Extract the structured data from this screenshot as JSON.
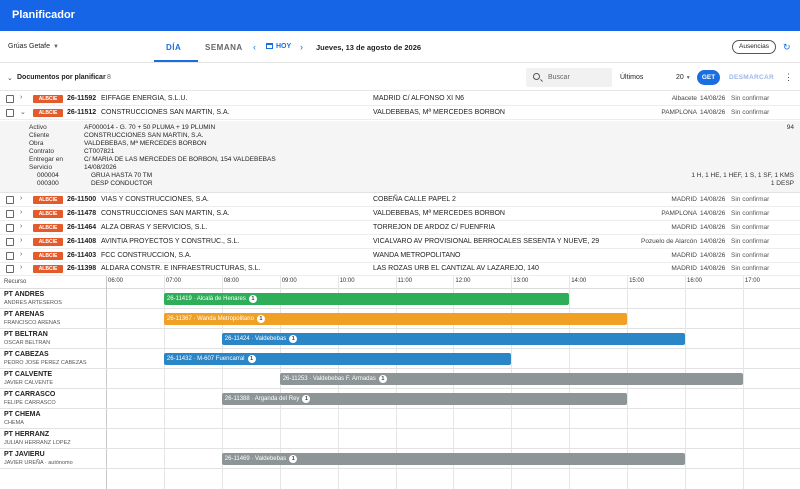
{
  "app": {
    "title": "Planificador"
  },
  "toolbar": {
    "crane_select": "Grúas Getafe",
    "tab_day": "DÍA",
    "tab_week": "SEMANA",
    "today_label": "HOY",
    "current_date": "Jueves, 13 de agosto de 2026",
    "absences_label": "Ausencias"
  },
  "pending": {
    "title": "Documentos por planificar",
    "count": "8",
    "search_placeholder": "Buscar",
    "last_label": "Últimos",
    "last_value": "20",
    "get_label": "GET",
    "unmark_label": "DESMARCAR"
  },
  "docs": [
    {
      "badge": "ALBCIE",
      "code": "26-11592",
      "client": "EIFFAGE ENERGIA, S.L.U.",
      "address": "MADRID C/ ALFONSO XI N6",
      "city": "Albacete",
      "date": "14/08/26",
      "status": "Sin confirmar"
    },
    {
      "badge": "ALBCIE",
      "code": "26-11512",
      "client": "CONSTRUCCIONES SAN MARTIN, S.A.",
      "address": "VALDEBEBAS, Mª MERCEDES BORBON",
      "city": "PAMPLONA",
      "date": "14/08/26",
      "status": "Sin confirmar"
    },
    {
      "badge": "ALBCIE",
      "code": "26-11500",
      "client": "VIAS Y CONSTRUCCIONES, S.A.",
      "address": "COBEÑA CALLE PAPEL 2",
      "city": "MADRID",
      "date": "14/08/26",
      "status": "Sin confirmar"
    },
    {
      "badge": "ALBCIE",
      "code": "26-11478",
      "client": "CONSTRUCCIONES SAN MARTIN, S.A.",
      "address": "VALDEBEBAS, Mª MERCEDES BORBON",
      "city": "PAMPLONA",
      "date": "14/08/26",
      "status": "Sin confirmar"
    },
    {
      "badge": "ALBCIE",
      "code": "26-11464",
      "client": "ALZA OBRAS Y SERVICIOS, S.L.",
      "address": "TORREJON DE ARDOZ C/ FUENFRIA",
      "city": "MADRID",
      "date": "14/08/26",
      "status": "Sin confirmar"
    },
    {
      "badge": "ALBCIE",
      "code": "26-11408",
      "client": "AVINTIA PROYECTOS Y CONSTRUC., S.L.",
      "address": "VICALVARO AV PROVISIONAL BERROCALES SESENTA Y NUEVE, 29",
      "city": "Pozuelo de Alarcón",
      "date": "14/08/26",
      "status": "Sin confirmar"
    },
    {
      "badge": "ALBCIE",
      "code": "26-11403",
      "client": "FCC CONSTRUCCION, S.A.",
      "address": "WANDA METROPOLITANO",
      "city": "MADRID",
      "date": "14/08/26",
      "status": "Sin confirmar"
    },
    {
      "badge": "ALBCIE",
      "code": "26-11398",
      "client": "ALDARA CONSTR. E INFRAESTRUCTURAS, S.L.",
      "address": "LAS ROZAS URB EL CANTIZAL AV LAZAREJO, 140",
      "city": "MADRID",
      "date": "14/08/26",
      "status": "Sin confirmar"
    }
  ],
  "detail": {
    "active_label": "Activo",
    "active_value": "AF000014 - G. 70 + 50 PLUMA + 19 PLUMIN",
    "active_right": "94",
    "client_label": "Cliente",
    "client_value": "CONSTRUCCIONES SAN MARTIN, S.A.",
    "work_label": "Obra",
    "work_value": "VALDEBEBAS, Mª MERCEDES BORBON",
    "contract_label": "Contrato",
    "contract_value": "CT007821",
    "deliver_label_1": "Entregar en",
    "deliver_value": "C/ MARIA DE LAS MERCEDES DE BORBON, 154 VALDEBEBAS",
    "service_label": "Servicio",
    "service_value": "14/08/2026",
    "lines": [
      {
        "code": "000004",
        "desc": "GRUA HASTA 70 TM",
        "right": "1 H, 1 HE, 1 HEF, 1 S, 1 SF, 1 KMS"
      },
      {
        "code": "000300",
        "desc": "DESP CONDUCTOR",
        "right": "1 DESP"
      }
    ]
  },
  "timeline": {
    "resource_header": "Recurso",
    "hours": [
      "06:00",
      "07:00",
      "08:00",
      "09:00",
      "10:00",
      "11:00",
      "12:00",
      "13:00",
      "14:00",
      "15:00",
      "16:00",
      "17:00"
    ],
    "resources": [
      {
        "name": "PT ANDRES",
        "sub": "ANDRES ARTESEROS",
        "bar": {
          "label": "26-11419 · Alcalá de Henares",
          "count": "1",
          "color": "#2fae5a",
          "start": 7.0,
          "end": 14.0
        }
      },
      {
        "name": "PT ARENAS",
        "sub": "FRANCISCO ARENAS",
        "bar": {
          "label": "26-11367 · Wanda Metropolitano",
          "count": "1",
          "color": "#f0a024",
          "start": 7.0,
          "end": 15.0
        }
      },
      {
        "name": "PT BELTRAN",
        "sub": "OSCAR BELTRAN",
        "bar": {
          "label": "26-11424 · Valdebebas",
          "count": "1",
          "color": "#2b86c8",
          "start": 8.0,
          "end": 16.0
        }
      },
      {
        "name": "PT CABEZAS",
        "sub": "PEDRO JOSE PEREZ CABEZAS",
        "bar": {
          "label": "26-11432 · M-607 Fuencarral",
          "count": "1",
          "color": "#2b86c8",
          "start": 7.0,
          "end": 13.0
        }
      },
      {
        "name": "PT CALVENTE",
        "sub": "JAVIER CALVENTE",
        "bar": {
          "label": "26-11253 · Valdebebas F. Armadas",
          "count": "1",
          "color": "#8e9597",
          "start": 9.0,
          "end": 17.0
        }
      },
      {
        "name": "PT CARRASCO",
        "sub": "FELIPE CARRASCO",
        "bar": {
          "label": "26-11388 · Arganda del Rey",
          "count": "1",
          "color": "#8e9597",
          "start": 8.0,
          "end": 15.0
        }
      },
      {
        "name": "PT CHEMA",
        "sub": "CHEMA",
        "bar": null
      },
      {
        "name": "PT HERRANZ",
        "sub": "JULIAN HERRANZ LOPEZ",
        "bar": null
      },
      {
        "name": "PT JAVIERU",
        "sub": "JAVIER UREÑA · autónomo",
        "bar": {
          "label": "26-11469 · Valdebebas",
          "count": "1",
          "color": "#8e9597",
          "start": 8.0,
          "end": 16.0
        }
      }
    ]
  }
}
